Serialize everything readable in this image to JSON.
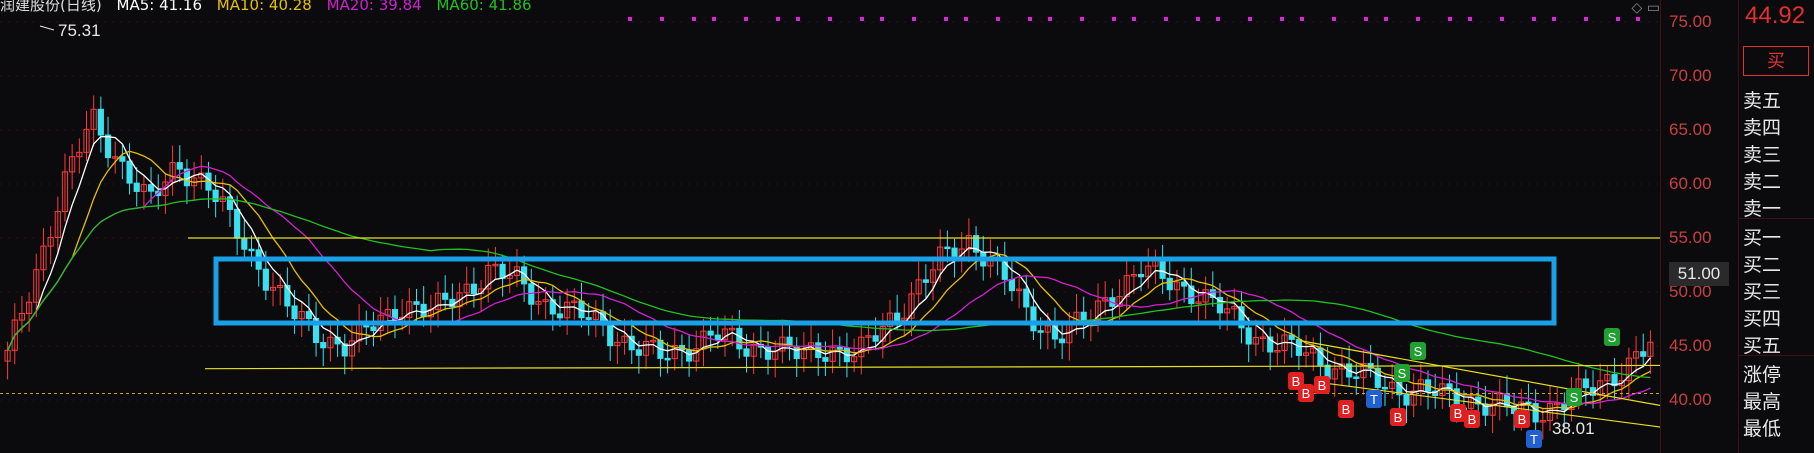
{
  "legend": {
    "title": "润建股份(日线)",
    "ma5": "MA5: 41.16",
    "ma10": "MA10: 40.28",
    "ma20": "MA20: 39.84",
    "ma60": "MA60: 41.86"
  },
  "colors": {
    "ma5": "#ffffff",
    "ma10": "#e8c000",
    "ma20": "#d020d0",
    "ma60": "#20c020",
    "up": "#ff3a3a",
    "down": "#3ae0f0",
    "box": "#1aa0e8",
    "trend": "#e8e020"
  },
  "annotations": {
    "high_label": "75.31",
    "low_label": "38.01",
    "markers": [
      "B",
      "B",
      "B",
      "B",
      "B",
      "B",
      "B",
      "B",
      "S",
      "S",
      "S",
      "S",
      "T",
      "T"
    ]
  },
  "axis": {
    "ticks": [
      "75.00",
      "70.00",
      "65.00",
      "60.00",
      "55.00",
      "50.00",
      "45.00",
      "40.00"
    ],
    "current_label": "51.00"
  },
  "quote": {
    "last_price": "44.92",
    "buy_button": "买",
    "sell_levels": [
      "卖五",
      "卖四",
      "卖三",
      "卖二",
      "卖一"
    ],
    "buy_levels": [
      "买一",
      "买二",
      "买三",
      "买四",
      "买五"
    ],
    "stats": [
      "涨停",
      "最高",
      "最低"
    ]
  },
  "chart_data": {
    "type": "candlestick",
    "ylim": [
      37,
      77
    ],
    "close_series_approx": [
      44,
      52,
      60,
      66,
      62,
      58,
      62,
      60,
      56,
      52,
      48,
      46,
      45,
      47,
      49,
      48,
      50,
      52,
      51,
      49,
      48,
      47,
      45,
      44,
      45,
      46,
      45,
      45,
      44,
      45,
      44,
      47,
      50,
      53,
      55,
      52,
      48,
      46,
      47,
      50,
      52,
      51,
      50,
      48,
      46,
      45,
      44,
      43,
      42,
      41,
      41,
      40,
      40,
      39,
      39,
      40,
      41,
      43,
      45
    ],
    "ma_values": {
      "MA5": 41.16,
      "MA10": 40.28,
      "MA20": 39.84,
      "MA60": 41.86
    }
  }
}
